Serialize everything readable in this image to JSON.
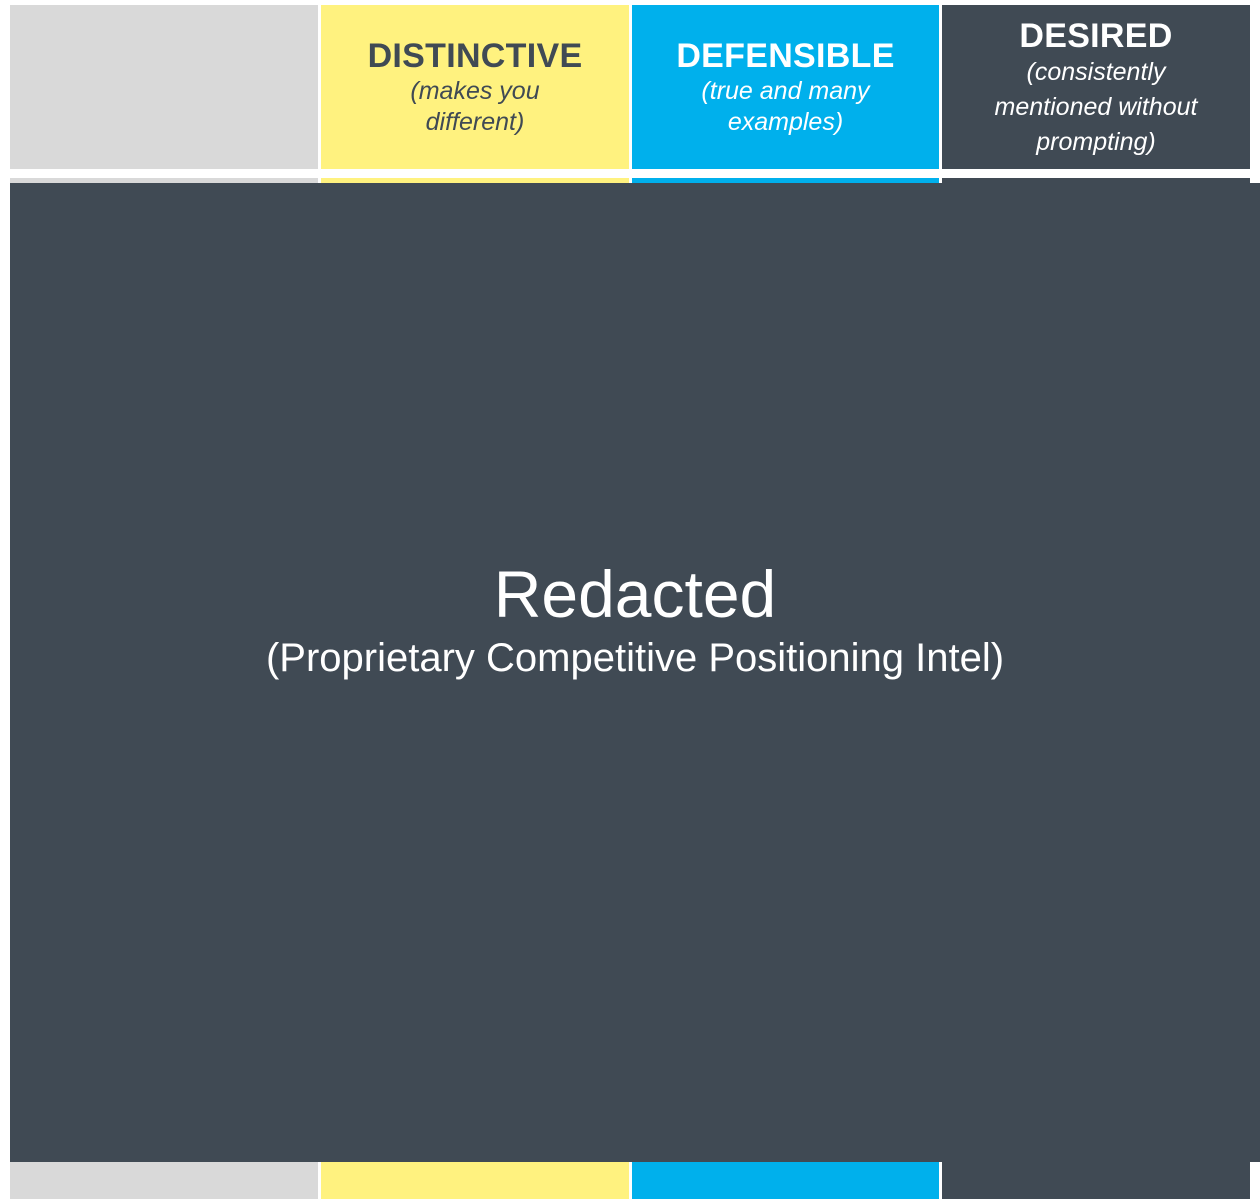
{
  "columns": [
    {
      "key": "blank",
      "title": "",
      "subtitle": "",
      "color": "#d9d9d9"
    },
    {
      "key": "distinctive",
      "title": "DISTINCTIVE",
      "subtitle": "(makes you different)",
      "color": "#fff27f"
    },
    {
      "key": "defensible",
      "title": "DEFENSIBLE",
      "subtitle": "(true and many examples)",
      "color": "#00b0ec"
    },
    {
      "key": "desired",
      "title": "DESIRED",
      "subtitle": "(consistently mentioned without prompting)",
      "color": "#404a54"
    }
  ],
  "redaction": {
    "title": "Redacted",
    "subtitle": "(Proprietary Competitive Positioning Intel)",
    "color": "#404a54"
  }
}
